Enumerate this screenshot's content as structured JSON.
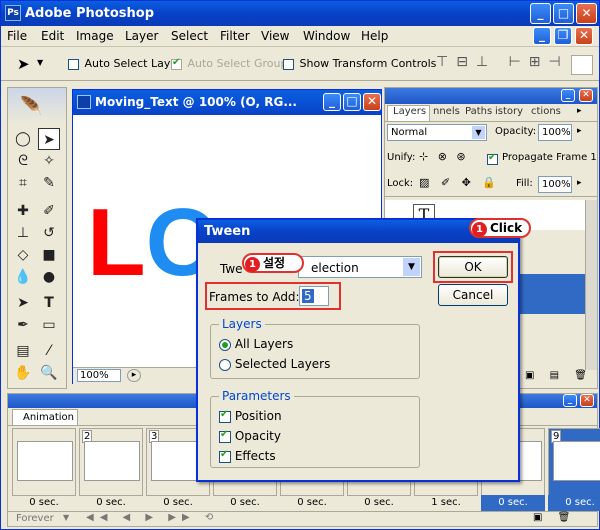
{
  "app": {
    "title": "Adobe Photoshop"
  },
  "menu": [
    "File",
    "Edit",
    "Image",
    "Layer",
    "Select",
    "Filter",
    "View",
    "Window",
    "Help"
  ],
  "options_bar": {
    "auto_select_layer": "Auto Select Layer",
    "auto_select_groups": "Auto Select Groups",
    "show_transform": "Show Transform Controls"
  },
  "document": {
    "title": "Moving_Text @ 100% (O, RG...",
    "zoom": "100%",
    "canvas_text": "LO",
    "canvas_l_color": "#ff0000",
    "canvas_o_color": "#1e8cf0"
  },
  "layers": {
    "tabs": [
      "Layers",
      "nnels",
      "Paths",
      "istory",
      "ctions"
    ],
    "blend_mode": "Normal",
    "opacity_label": "Opacity:",
    "opacity": "100%",
    "unify_label": "Unify:",
    "propagate": "Propagate Frame 1",
    "lock_label": "Lock:",
    "fill_label": "Fill:",
    "fill": "100%",
    "layer_glyph": "T"
  },
  "animation": {
    "tab": "Animation",
    "frames": [
      {
        "num": "",
        "delay": "0 sec."
      },
      {
        "num": "2",
        "delay": "0 sec."
      },
      {
        "num": "3",
        "delay": "0 sec."
      },
      {
        "num": "",
        "delay": "0 sec."
      },
      {
        "num": "",
        "delay": "0 sec."
      },
      {
        "num": "",
        "delay": "0 sec."
      },
      {
        "num": "",
        "delay": "1 sec."
      },
      {
        "num": "",
        "delay": "0 sec."
      },
      {
        "num": "9",
        "delay": "0 sec."
      }
    ],
    "loop": "Forever"
  },
  "tween": {
    "title": "Tween",
    "tween_with_label": "Twe",
    "tween_with_value": "election",
    "frames_to_add_label": "Frames to Add:",
    "frames_to_add_value": "5",
    "ok": "OK",
    "cancel": "Cancel",
    "layers_group": "Layers",
    "all_layers": "All Layers",
    "selected_layers": "Selected Layers",
    "parameters_group": "Parameters",
    "position": "Position",
    "opacity": "Opacity",
    "effects": "Effects"
  },
  "annotations": {
    "badge1": "1",
    "setting": "설정",
    "badge2": "1",
    "click": "Click"
  }
}
